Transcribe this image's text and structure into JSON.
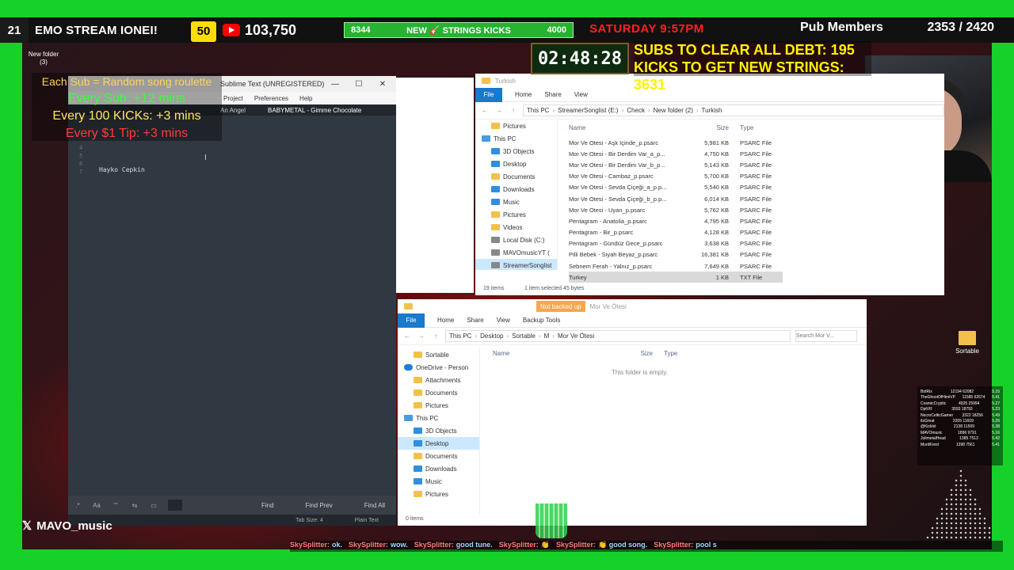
{
  "overlay": {
    "sub_badge": "21",
    "stream_title": "EMO STREAM IONEI!",
    "sub_count": "50",
    "youtube_count": "103,750",
    "kicks_left": "8344",
    "kicks_label": "NEW 🎸 STRINGS KICKS",
    "kicks_goal": "4000",
    "date": "SATURDAY 9:57PM",
    "pub_label": "Pub Members",
    "pub_count": "2353 / 2420",
    "timer": "02:48:28",
    "debt_line1": "SUBS TO CLEAR ALL DEBT: 195",
    "debt_line2": "KICKS TO GET NEW STRINGS: 3631",
    "rules": [
      "Each Sub = Random song roulette",
      "Every Sub: +12 mins",
      "Every 100 KICKs: +3 mins",
      "Every $1 Tip: +3 mins"
    ],
    "new_folder": "New folder",
    "new_folder_count": "(3)",
    "twitter": "MAVO_music",
    "desktop_icon": "Sortable",
    "chat": [
      {
        "user": "SkySplitter:",
        "msg": "ok."
      },
      {
        "user": "SkySplitter:",
        "msg": "wow."
      },
      {
        "user": "SkySplitter:",
        "msg": "good tune."
      },
      {
        "user": "SkySplitter:",
        "msg": "👏"
      },
      {
        "user": "SkySplitter:",
        "msg": "👏 good song."
      },
      {
        "user": "SkySplitter:",
        "msg": "pool s"
      }
    ],
    "leaderboard": [
      [
        "BotRix",
        "12194 62082",
        "5.15"
      ],
      [
        "TheGhostOfHimiVP",
        "11585 62674",
        "5.41"
      ],
      [
        "CosmicCryptic",
        "4925 25994",
        "5.27"
      ],
      [
        "DptVR",
        "3593 18793",
        "5.23"
      ],
      [
        "NecroCelticGamer",
        "3322 18256",
        "5.49"
      ],
      [
        "itzGreat",
        "2205 11609",
        "5.26"
      ],
      [
        "@Kicklst",
        "2138 11509",
        "5.38"
      ],
      [
        "MAVOmusic",
        "1896 9791",
        "5.16"
      ],
      [
        "JulimetalHead",
        "1385 7513",
        "5.42"
      ],
      [
        "MurdKrest",
        "1398 7561",
        "5.41"
      ]
    ]
  },
  "sublime": {
    "title": "Sublime Text (UNREGISTERED)",
    "menu": [
      "Project",
      "Preferences",
      "Help"
    ],
    "tabs": [
      "An Angel",
      "BABYMETAL - Gimme Chocolate"
    ],
    "line_numbers": [
      "4",
      "5",
      "6",
      "7"
    ],
    "code_line": "Hayko Cepkin",
    "find_buttons": [
      "Find",
      "Find Prev",
      "Find All"
    ],
    "status_tab": "Tab Size: 4",
    "status_syntax": "Plain Text"
  },
  "explorer1": {
    "title": "Turkish",
    "ribbon": [
      "File",
      "Home",
      "Share",
      "View"
    ],
    "crumbs": [
      "This PC",
      "StreamerSonglist (E:)",
      "Check",
      "New folder (2)",
      "Turkish"
    ],
    "nav": [
      {
        "label": "Pictures",
        "icon": "folder",
        "level": "sub"
      },
      {
        "label": "This PC",
        "icon": "pc",
        "level": "top"
      },
      {
        "label": "3D Objects",
        "icon": "blue",
        "level": "sub"
      },
      {
        "label": "Desktop",
        "icon": "blue",
        "level": "sub"
      },
      {
        "label": "Documents",
        "icon": "folder",
        "level": "sub"
      },
      {
        "label": "Downloads",
        "icon": "blue",
        "level": "sub"
      },
      {
        "label": "Music",
        "icon": "blue",
        "level": "sub"
      },
      {
        "label": "Pictures",
        "icon": "folder",
        "level": "sub"
      },
      {
        "label": "Videos",
        "icon": "folder",
        "level": "sub"
      },
      {
        "label": "Local Disk (C:)",
        "icon": "drive",
        "level": "sub"
      },
      {
        "label": "MAVOmusicYT (",
        "icon": "drive",
        "level": "sub"
      },
      {
        "label": "StreamerSonglist",
        "icon": "drive",
        "level": "sub",
        "selected": true
      }
    ],
    "columns": [
      "Name",
      "Size",
      "Type"
    ],
    "files": [
      {
        "name": "Mor Ve Otesi - Aşk Içinde_p.psarc",
        "size": "5,981 KB",
        "type": "PSARC File"
      },
      {
        "name": "Mor Ve Otesi - Bir Derdim Var_a_p...",
        "size": "4,750 KB",
        "type": "PSARC File"
      },
      {
        "name": "Mor Ve Otesi - Bir Derdim Var_b_p...",
        "size": "5,143 KB",
        "type": "PSARC File"
      },
      {
        "name": "Mor Ve Otesi - Cambaz_p.psarc",
        "size": "5,700 KB",
        "type": "PSARC File"
      },
      {
        "name": "Mor Ve Otesi - Sevda Çiçeği_a_p.p...",
        "size": "5,540 KB",
        "type": "PSARC File"
      },
      {
        "name": "Mor Ve Otesi - Sevda Çiçeği_b_p.p...",
        "size": "6,014 KB",
        "type": "PSARC File"
      },
      {
        "name": "Mor Ve Otesi - Uyan_p.psarc",
        "size": "5,762 KB",
        "type": "PSARC File"
      },
      {
        "name": "Pentagram - Anatolia_p.psarc",
        "size": "4,795 KB",
        "type": "PSARC File"
      },
      {
        "name": "Pentagram - Bir_p.psarc",
        "size": "4,128 KB",
        "type": "PSARC File"
      },
      {
        "name": "Pentagram - Gündüz Gece_p.psarc",
        "size": "3,638 KB",
        "type": "PSARC File"
      },
      {
        "name": "Pilli Bebek - Siyah Beyaz_p.psarc",
        "size": "16,381 KB",
        "type": "PSARC File"
      },
      {
        "name": "Sebnem Ferah - Yalnız_p.psarc",
        "size": "7,649 KB",
        "type": "PSARC File"
      },
      {
        "name": "Turkey",
        "size": "1 KB",
        "type": "TXT File",
        "selected": true
      }
    ],
    "status": "19 items",
    "status_sel": "1 item selected  45 bytes"
  },
  "explorer2": {
    "title": "Mor Ve Ötesi",
    "badge": "Not backed up",
    "ribbon": [
      "File",
      "Home",
      "Share",
      "View",
      "Backup Tools"
    ],
    "crumbs": [
      "This PC",
      "Desktop",
      "Sortable",
      "M",
      "Mor Ve Ötesi"
    ],
    "search_placeholder": "Search Mor V...",
    "nav": [
      {
        "label": "Sortable",
        "icon": "folder",
        "level": "sub"
      },
      {
        "label": "OneDrive - Person",
        "icon": "cloud",
        "level": "top"
      },
      {
        "label": "Attachments",
        "icon": "folder",
        "level": "sub"
      },
      {
        "label": "Documents",
        "icon": "folder",
        "level": "sub"
      },
      {
        "label": "Pictures",
        "icon": "folder",
        "level": "sub"
      },
      {
        "label": "This PC",
        "icon": "pc",
        "level": "top"
      },
      {
        "label": "3D Objects",
        "icon": "blue",
        "level": "sub"
      },
      {
        "label": "Desktop",
        "icon": "blue",
        "level": "sub",
        "selected": true
      },
      {
        "label": "Documents",
        "icon": "folder",
        "level": "sub"
      },
      {
        "label": "Downloads",
        "icon": "blue",
        "level": "sub"
      },
      {
        "label": "Music",
        "icon": "blue",
        "level": "sub"
      },
      {
        "label": "Pictures",
        "icon": "folder",
        "level": "sub"
      }
    ],
    "columns": [
      "Name",
      "Size",
      "Type"
    ],
    "empty": "This folder is empty.",
    "status": "0 items"
  }
}
